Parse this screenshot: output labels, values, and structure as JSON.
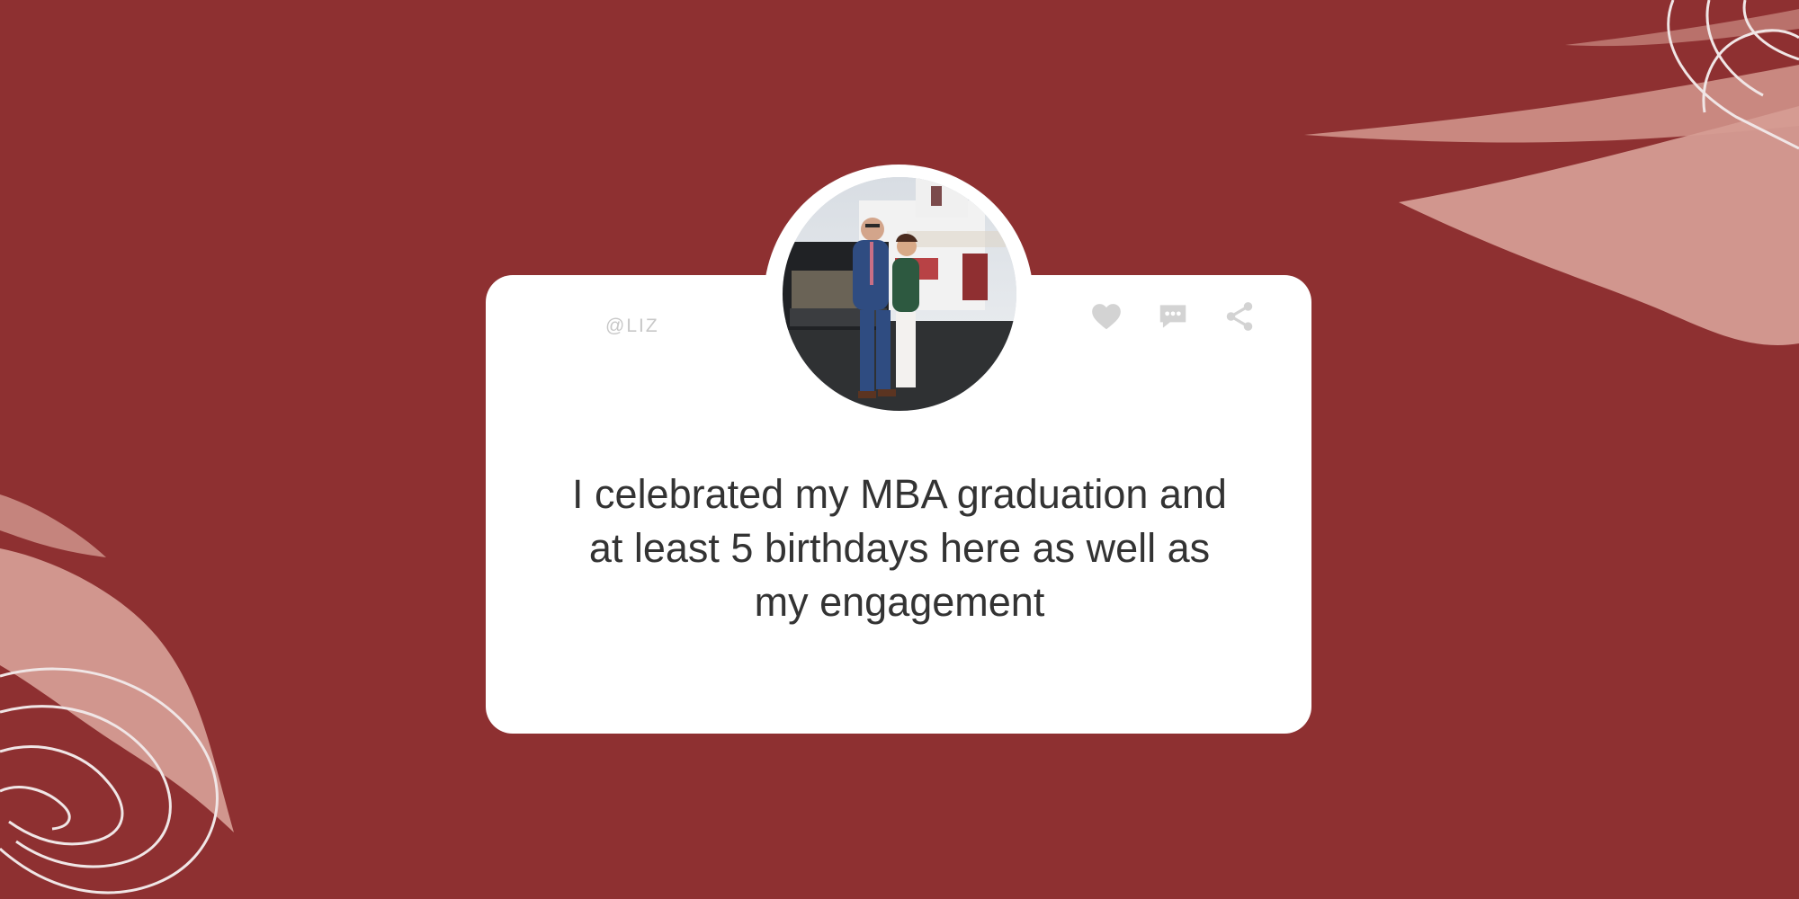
{
  "post": {
    "handle": "@LIZ",
    "message": "I celebrated my MBA graduation and at least 5 birthdays here as well as my engagement"
  },
  "actions": {
    "like": {
      "icon": "heart-icon"
    },
    "comment": {
      "icon": "comment-icon"
    },
    "share": {
      "icon": "share-icon"
    }
  },
  "colors": {
    "background": "#8e3031",
    "card": "#ffffff",
    "text": "#333333",
    "muted": "#c8c8c8",
    "brush": "#d59c93"
  }
}
